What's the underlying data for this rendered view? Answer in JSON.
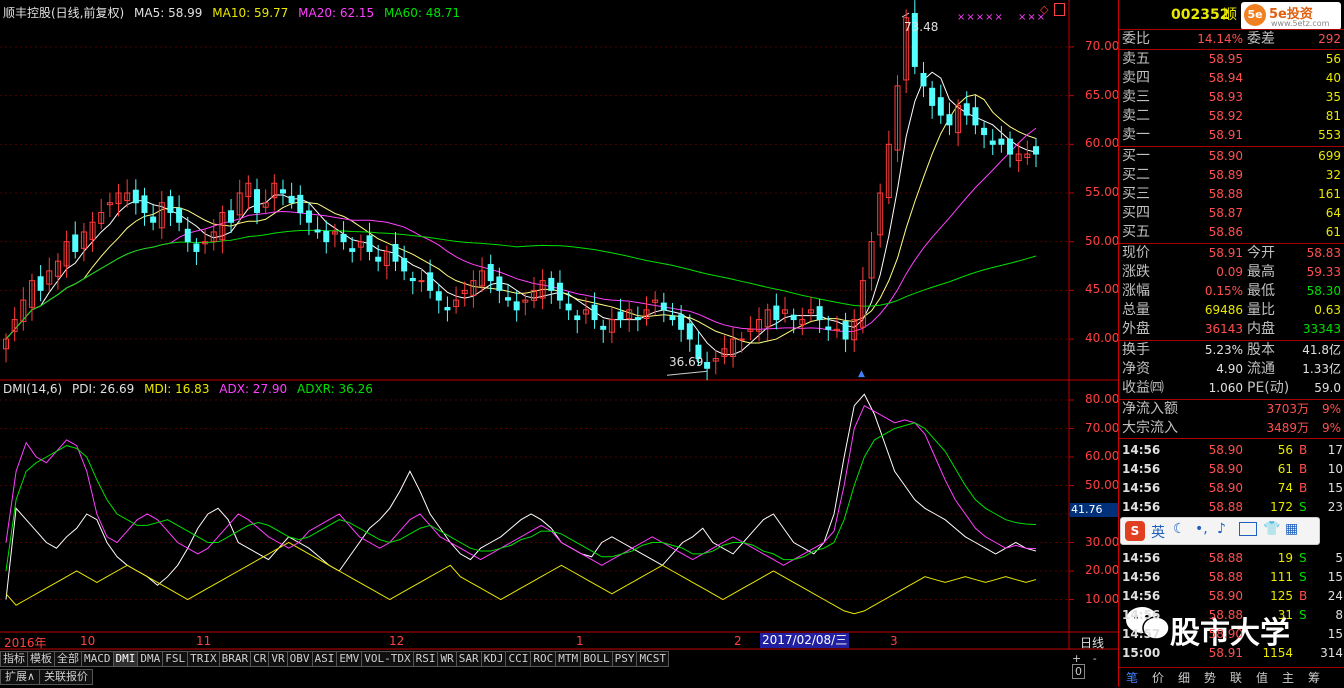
{
  "main_legend": {
    "name": "顺丰控股(日线,前复权)",
    "ma5": "MA5: 58.99",
    "ma10": "MA10: 59.77",
    "ma20": "MA20: 62.15",
    "ma60": "MA60: 48.71"
  },
  "main_axis": [
    "70.00",
    "65.00",
    "60.00",
    "55.00",
    "50.00",
    "45.00",
    "40.00"
  ],
  "annotations": {
    "high": "73.48",
    "low": "36.69",
    "cross": "41.76"
  },
  "dmi_legend": {
    "name": "DMI(14,6)",
    "pdi": "PDI: 26.69",
    "mdi": "MDI: 16.83",
    "adx": "ADX: 27.90",
    "adxr": "ADXR: 36.26"
  },
  "dmi_axis": [
    "80.00",
    "70.00",
    "60.00",
    "50.00",
    "40.00",
    "30.00",
    "20.00",
    "10.00"
  ],
  "date_axis": {
    "year": "2016年",
    "m10": "10",
    "m11": "11",
    "m12": "12",
    "m1": "1",
    "m2": "2",
    "m3": "3",
    "cursor_date": "2017/02/08/三",
    "period": "日线"
  },
  "indicator_tabs": [
    "指标",
    "模板",
    "全部",
    "MACD",
    "DMI",
    "DMA",
    "FSL",
    "TRIX",
    "BRAR",
    "CR",
    "VR",
    "OBV",
    "ASI",
    "EMV",
    "VOL-TDX",
    "RSI",
    "WR",
    "SAR",
    "KDJ",
    "CCI",
    "ROC",
    "MTM",
    "BOLL",
    "PSY",
    "MCST"
  ],
  "bottom_tabs": [
    "扩展∧",
    "关联报价"
  ],
  "zoom_controls": [
    "+",
    "-",
    "0"
  ],
  "quote": {
    "code": "002352",
    "name": "顺",
    "brand": "5e投资",
    "brand_url": "www.5etz.com",
    "weibi_label": "委比",
    "weibi": "14.14%",
    "weicha_label": "委差",
    "weicha": "292",
    "sells": [
      {
        "label": "卖五",
        "price": "58.95",
        "vol": "56"
      },
      {
        "label": "卖四",
        "price": "58.94",
        "vol": "40"
      },
      {
        "label": "卖三",
        "price": "58.93",
        "vol": "35"
      },
      {
        "label": "卖二",
        "price": "58.92",
        "vol": "81"
      },
      {
        "label": "卖一",
        "price": "58.91",
        "vol": "553"
      }
    ],
    "buys": [
      {
        "label": "买一",
        "price": "58.90",
        "vol": "699"
      },
      {
        "label": "买二",
        "price": "58.89",
        "vol": "32"
      },
      {
        "label": "买三",
        "price": "58.88",
        "vol": "161"
      },
      {
        "label": "买四",
        "price": "58.87",
        "vol": "64"
      },
      {
        "label": "买五",
        "price": "58.86",
        "vol": "61"
      }
    ],
    "stats": [
      {
        "l1": "现价",
        "v1": "58.91",
        "l2": "今开",
        "v2": "58.83",
        "c1": "red",
        "c2": "red"
      },
      {
        "l1": "涨跌",
        "v1": "0.09",
        "l2": "最高",
        "v2": "59.33",
        "c1": "red",
        "c2": "red"
      },
      {
        "l1": "涨幅",
        "v1": "0.15%",
        "l2": "最低",
        "v2": "58.30",
        "c1": "red",
        "c2": "grn"
      },
      {
        "l1": "总量",
        "v1": "69486",
        "l2": "量比",
        "v2": "0.63",
        "c1": "yel",
        "c2": "yel"
      },
      {
        "l1": "外盘",
        "v1": "36143",
        "l2": "内盘",
        "v2": "33343",
        "c1": "red",
        "c2": "grn"
      }
    ],
    "stats2": [
      {
        "l1": "换手",
        "v1": "5.23%",
        "l2": "股本",
        "v2": "41.8亿"
      },
      {
        "l1": "净资",
        "v1": "4.90",
        "l2": "流通",
        "v2": "1.33亿"
      },
      {
        "l1": "收益㈣",
        "v1": "1.060",
        "l2": "PE(动)",
        "v2": "59.0"
      }
    ],
    "flows": [
      {
        "label": "净流入额",
        "value": "3703万",
        "pct": "9%"
      },
      {
        "label": "大宗流入",
        "value": "3489万",
        "pct": "9%"
      }
    ],
    "ticks": [
      {
        "t": "14:56",
        "p": "58.90",
        "v": "56",
        "d": "B",
        "n": "17"
      },
      {
        "t": "14:56",
        "p": "58.90",
        "v": "61",
        "d": "B",
        "n": "10"
      },
      {
        "t": "14:56",
        "p": "58.90",
        "v": "74",
        "d": "B",
        "n": "15"
      },
      {
        "t": "14:56",
        "p": "58.88",
        "v": "172",
        "d": "S",
        "n": "23"
      },
      {
        "t": "14:56",
        "p": "58.88",
        "v": "19",
        "d": "S",
        "n": "5"
      },
      {
        "t": "14:56",
        "p": "58.88",
        "v": "111",
        "d": "S",
        "n": "15"
      },
      {
        "t": "14:56",
        "p": "58.90",
        "v": "125",
        "d": "B",
        "n": "24"
      },
      {
        "t": "14:56",
        "p": "58.88",
        "v": "31",
        "d": "S",
        "n": "8"
      },
      {
        "t": "14:57",
        "p": "58.90",
        "v": "",
        "d": "",
        "n": "15"
      },
      {
        "t": "15:00",
        "p": "58.91",
        "v": "1154",
        "d": "",
        "n": "314"
      }
    ],
    "bottom_tabs": [
      "笔",
      "价",
      "细",
      "势",
      "联",
      "值",
      "主",
      "筹"
    ]
  },
  "watermark": "股市大学",
  "ime_bar": "英",
  "colors": {
    "up": "#ff3b3b",
    "down": "#54ffff",
    "ma5": "#ffffff",
    "ma10": "#ffff80",
    "ma20": "#ff40ff",
    "ma60": "#00e000",
    "axis": "#c00000"
  }
}
